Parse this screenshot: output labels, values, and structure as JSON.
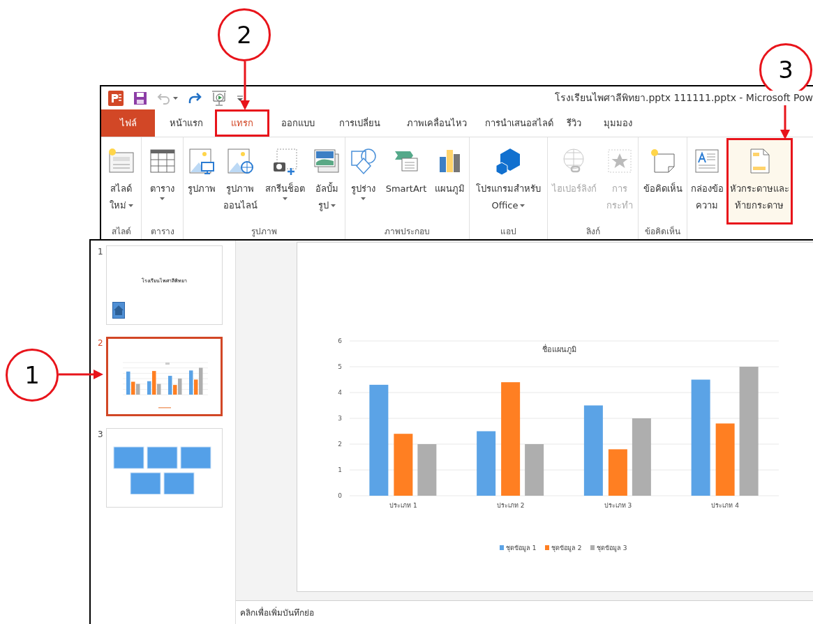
{
  "annotations": [
    {
      "label": "2"
    },
    {
      "label": "3"
    },
    {
      "label": "1"
    }
  ],
  "window": {
    "title": "โรงเรียนไพศาลีพิทยา.pptx 111111.pptx - Microsoft Pow"
  },
  "tabs": [
    {
      "label": "ไฟล์",
      "kind": "file",
      "selected": false,
      "highlighted": false
    },
    {
      "label": "หน้าแรก",
      "kind": "tab",
      "selected": false,
      "highlighted": false
    },
    {
      "label": "แทรก",
      "kind": "tab",
      "selected": true,
      "highlighted": true
    },
    {
      "label": "ออกแบบ",
      "kind": "tab",
      "selected": false,
      "highlighted": false
    },
    {
      "label": "การเปลี่ยน",
      "kind": "tab",
      "selected": false,
      "highlighted": false
    },
    {
      "label": "ภาพเคลื่อนไหว",
      "kind": "tab",
      "selected": false,
      "highlighted": false
    },
    {
      "label": "การนำเสนอสไลด์",
      "kind": "tab",
      "selected": false,
      "highlighted": false
    },
    {
      "label": "รีวิว",
      "kind": "tab",
      "selected": false,
      "highlighted": false
    },
    {
      "label": "มุมมอง",
      "kind": "tab",
      "selected": false,
      "highlighted": false
    }
  ],
  "ribbon_groups": [
    {
      "label": "สไลด์",
      "buttons": [
        {
          "lines": [
            "สไลด์",
            "ใหม่"
          ],
          "dropdown": true,
          "disabled": false,
          "highlighted": false
        }
      ]
    },
    {
      "label": "ตาราง",
      "buttons": [
        {
          "lines": [
            "ตาราง"
          ],
          "dropdown": true,
          "disabled": false,
          "highlighted": false
        }
      ]
    },
    {
      "label": "รูปภาพ",
      "buttons": [
        {
          "lines": [
            "รูปภาพ"
          ],
          "dropdown": false,
          "disabled": false,
          "highlighted": false
        },
        {
          "lines": [
            "รูปภาพ",
            "ออนไลน์"
          ],
          "dropdown": false,
          "disabled": false,
          "highlighted": false
        },
        {
          "lines": [
            "สกรีนช็อต"
          ],
          "dropdown": true,
          "disabled": false,
          "highlighted": false
        },
        {
          "lines": [
            "อัลบั้ม",
            "รูป"
          ],
          "dropdown": true,
          "disabled": false,
          "highlighted": false
        }
      ]
    },
    {
      "label": "ภาพประกอบ",
      "buttons": [
        {
          "lines": [
            "รูปร่าง"
          ],
          "dropdown": true,
          "disabled": false,
          "highlighted": false
        },
        {
          "lines": [
            "SmartArt"
          ],
          "dropdown": false,
          "disabled": false,
          "highlighted": false
        },
        {
          "lines": [
            "แผนภูมิ"
          ],
          "dropdown": false,
          "disabled": false,
          "highlighted": false
        }
      ]
    },
    {
      "label": "แอป",
      "buttons": [
        {
          "lines": [
            "โปรแกรมสำหรับ",
            "Office"
          ],
          "dropdown": true,
          "disabled": false,
          "highlighted": false
        }
      ]
    },
    {
      "label": "ลิงก์",
      "buttons": [
        {
          "lines": [
            "ไฮเปอร์ลิงก์"
          ],
          "dropdown": false,
          "disabled": true,
          "highlighted": false
        },
        {
          "lines": [
            "การ",
            "กระทำ"
          ],
          "dropdown": false,
          "disabled": true,
          "highlighted": false
        }
      ]
    },
    {
      "label": "ข้อคิดเห็น",
      "buttons": [
        {
          "lines": [
            "ข้อคิดเห็น"
          ],
          "dropdown": false,
          "disabled": false,
          "highlighted": false
        }
      ]
    },
    {
      "buttons": [
        {
          "lines": [
            "กล่องข้อ",
            "ความ"
          ],
          "dropdown": false,
          "disabled": false,
          "highlighted": false
        },
        {
          "lines": [
            "หัวกระดาษและ",
            "ท้ายกระดาษ"
          ],
          "dropdown": false,
          "disabled": false,
          "highlighted": true
        }
      ]
    }
  ],
  "slides": [
    {
      "number": "1",
      "kind": "title",
      "title": "โรงเรียนไพศาลีพิทยา",
      "selected": false
    },
    {
      "number": "2",
      "kind": "chart",
      "selected": true
    },
    {
      "number": "3",
      "kind": "shapes",
      "selected": false
    }
  ],
  "slide": {
    "chart_data": {
      "type": "bar",
      "title": "ชื่อแผนภูมิ",
      "categories": [
        "ประเภท 1",
        "ประเภท 2",
        "ประเภท 3",
        "ประเภท 4"
      ],
      "series": [
        {
          "name": "ชุดข้อมูล 1",
          "color": "#5ba3e6",
          "values": [
            4.3,
            2.5,
            3.5,
            4.5
          ]
        },
        {
          "name": "ชุดข้อมูล 2",
          "color": "#ff7f22",
          "values": [
            2.4,
            4.4,
            1.8,
            2.8
          ]
        },
        {
          "name": "ชุดข้อมูล 3",
          "color": "#aeaeae",
          "values": [
            2,
            2,
            3,
            5
          ]
        }
      ],
      "ylim": [
        0,
        6
      ],
      "yticks": [
        0,
        1,
        2,
        3,
        4,
        5,
        6
      ],
      "grid": true,
      "legend": true
    }
  },
  "notes": {
    "placeholder": "คลิกเพื่อเพิ่มบันทึกย่อ"
  }
}
